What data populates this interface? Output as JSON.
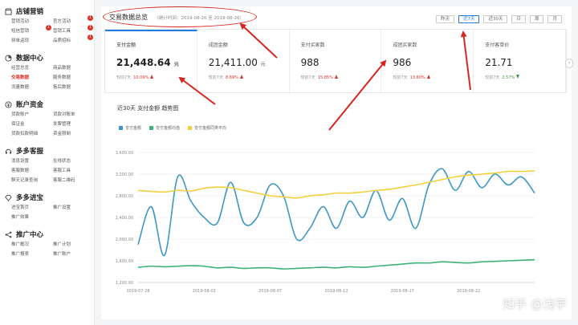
{
  "sidebar": {
    "groups": [
      {
        "title": "店铺营销",
        "icon": "store-icon",
        "items": [
          {
            "label": "营销活动",
            "active": false
          },
          {
            "label": "官方活动",
            "active": false,
            "badge": "1"
          },
          {
            "label": "短信营销",
            "active": false,
            "badge": "1"
          },
          {
            "label": "营销工具",
            "active": false,
            "badge": "1"
          },
          {
            "label": "拼单返现",
            "active": false
          },
          {
            "label": "品质招标",
            "active": false,
            "badge": "1"
          }
        ]
      },
      {
        "title": "数据中心",
        "icon": "chart-icon",
        "items": [
          {
            "label": "经营总览",
            "active": false
          },
          {
            "label": "商品数据",
            "active": false
          },
          {
            "label": "交易数据",
            "active": true
          },
          {
            "label": "服务数据",
            "active": false
          },
          {
            "label": "流量数据",
            "active": false
          },
          {
            "label": "售后数据",
            "active": false
          }
        ]
      },
      {
        "title": "账户资金",
        "icon": "wallet-icon",
        "items": [
          {
            "label": "货款账户",
            "active": false
          },
          {
            "label": "货款对账单",
            "active": false
          },
          {
            "label": "保证金",
            "active": false
          },
          {
            "label": "发票管理",
            "active": false
          },
          {
            "label": "货款扣款明细",
            "active": false
          },
          {
            "label": "资金限制",
            "active": false
          }
        ]
      },
      {
        "title": "多多客服",
        "icon": "headset-icon",
        "items": [
          {
            "label": "消息设置",
            "active": false
          },
          {
            "label": "在线状态",
            "active": false
          },
          {
            "label": "客服数据",
            "active": false
          },
          {
            "label": "客服工具",
            "active": false
          },
          {
            "label": "聊天记录查询",
            "active": false
          },
          {
            "label": "客服二维码",
            "active": false
          }
        ]
      },
      {
        "title": "多多进宝",
        "icon": "gem-icon",
        "items": [
          {
            "label": "进宝首页",
            "active": false
          },
          {
            "label": "推广设置",
            "active": false
          },
          {
            "label": "推广效果",
            "active": false
          }
        ]
      },
      {
        "title": "推广中心",
        "icon": "share-icon",
        "items": [
          {
            "label": "推广概况",
            "active": false
          },
          {
            "label": "推广计划",
            "active": false
          },
          {
            "label": "推广报表",
            "active": false
          },
          {
            "label": "推广账户",
            "active": false
          }
        ]
      }
    ]
  },
  "header": {
    "title": "交易数据总览",
    "note": "（统计时间：2019-08-26 至 2019-08-26）"
  },
  "ranges": [
    {
      "label": "昨天",
      "active": false
    },
    {
      "label": "近7天",
      "active": true
    },
    {
      "label": "近30天",
      "active": false
    },
    {
      "label": "日",
      "active": false
    },
    {
      "label": "周",
      "active": false
    },
    {
      "label": "月",
      "active": false
    }
  ],
  "cards": [
    {
      "label": "支付金额",
      "value": "21,448.64",
      "unit": "元",
      "compare": "较前7天",
      "pct": "10.09%",
      "dir": "up",
      "active": true
    },
    {
      "label": "成团金额",
      "value": "21,411.00",
      "unit": "元",
      "compare": "较前7天",
      "pct": "8.69%",
      "dir": "up",
      "active": false
    },
    {
      "label": "支付买家数",
      "value": "988",
      "unit": "",
      "compare": "较前7天",
      "pct": "15.85%",
      "dir": "up",
      "active": false
    },
    {
      "label": "成团买家数",
      "value": "986",
      "unit": "",
      "compare": "较前7天",
      "pct": "13.60%",
      "dir": "up",
      "active": false
    },
    {
      "label": "支付客单价",
      "value": "21.71",
      "unit": "",
      "compare": "较前7天",
      "pct": "2.57%",
      "dir": "down",
      "active": false
    }
  ],
  "chart_title": "近30天 支付金额 趋势图",
  "watermark": "知乎 @浅宇",
  "chart_data": {
    "type": "line",
    "title": "近30天 支付金额 趋势图",
    "xlabel": "",
    "ylabel": "",
    "ylim": [
      1200,
      3600
    ],
    "yticks": [
      "1,200.00",
      "1,600.00",
      "2,000.00",
      "2,400.00",
      "2,800.00",
      "3,200.00",
      "3,600.00"
    ],
    "yticks_values": [
      1200,
      1600,
      2000,
      2400,
      2800,
      3200,
      3600
    ],
    "xticks": [
      "2019-07-28",
      "2019-08-02",
      "2019-08-07",
      "2019-08-12",
      "2019-08-17",
      "2019-08-22"
    ],
    "xticks_index": [
      0,
      5,
      10,
      15,
      20,
      25
    ],
    "legend_position": "top-left",
    "grid": true,
    "series": [
      {
        "name": "支付金额",
        "color": "#3f97c9",
        "values": [
          1900,
          2600,
          1700,
          3150,
          2700,
          2400,
          2300,
          3050,
          2300,
          2400,
          3000,
          2800,
          2000,
          2200,
          2600,
          2200,
          2700,
          2400,
          2900,
          2350,
          2750,
          2200,
          3000,
          3300,
          2900,
          3250,
          2950,
          3200,
          3000,
          3150,
          2850
        ]
      },
      {
        "name": "支付金额均值",
        "color": "#3db27a",
        "values": [
          1480,
          1500,
          1490,
          1500,
          1510,
          1500,
          1470,
          1480,
          1460,
          1470,
          1470,
          1450,
          1460,
          1470,
          1480,
          1470,
          1490,
          1480,
          1500,
          1520,
          1540,
          1560,
          1560,
          1580,
          1570,
          1560,
          1580,
          1590,
          1600,
          1610,
          1620
        ]
      },
      {
        "name": "支付金额同类平均",
        "color": "#f2cf3b",
        "values": [
          2900,
          2880,
          2870,
          2900,
          2890,
          2940,
          2960,
          2950,
          2900,
          2850,
          2800,
          2780,
          2760,
          2800,
          2820,
          2850,
          2850,
          2870,
          2900,
          2920,
          2960,
          3000,
          3050,
          3100,
          3150,
          3180,
          3200,
          3220,
          3250,
          3250,
          3260
        ]
      }
    ]
  }
}
